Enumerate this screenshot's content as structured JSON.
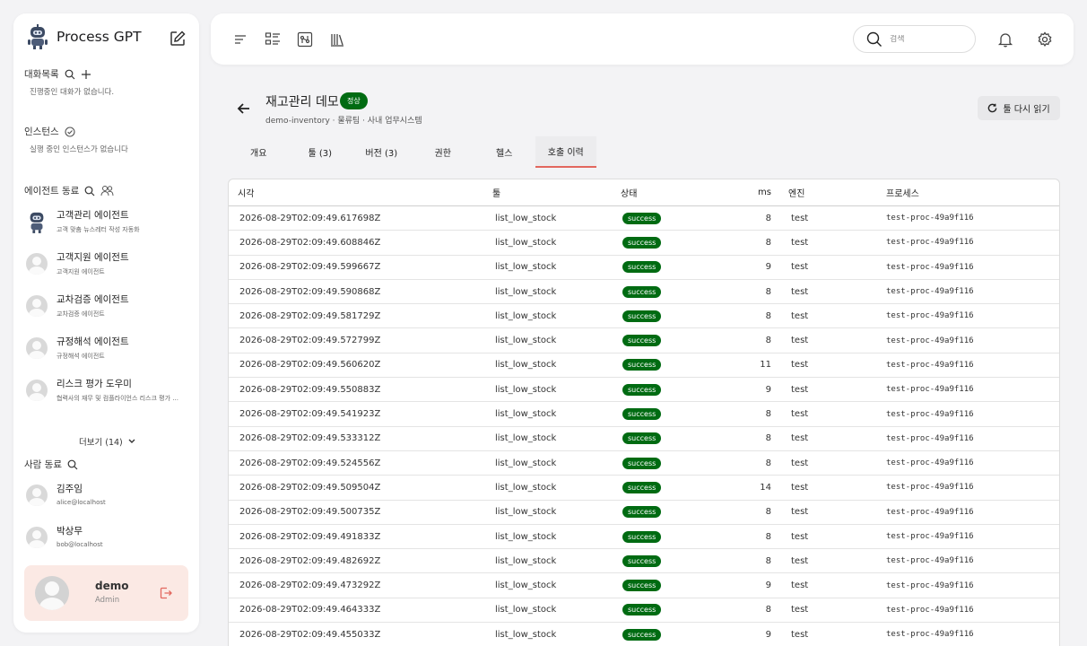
{
  "app": {
    "title": "Process GPT"
  },
  "sidebar": {
    "chats": {
      "title": "대화목록",
      "empty": "진행중인 대화가 없습니다."
    },
    "instances": {
      "title": "인스턴스",
      "empty": "실행 중인 인스턴스가 없습니다"
    },
    "agents": {
      "title": "에이전트 동료",
      "items": [
        {
          "name": "고객관리 에이전트",
          "desc": "고객 맞춤 뉴스레터 작성 자동화"
        },
        {
          "name": "고객지원 에이전트",
          "desc": "고객지원 에이전트"
        },
        {
          "name": "교차검증 에이전트",
          "desc": "교차검증 에이전트"
        },
        {
          "name": "규정해석 에이전트",
          "desc": "규정해석 에이전트"
        },
        {
          "name": "리스크 평가 도우미",
          "desc": "협력사의 재무 및 컴플라이언스 리스크 평가 ..."
        }
      ],
      "more": "더보기 (14)"
    },
    "people": {
      "title": "사람 동료",
      "items": [
        {
          "name": "김주임",
          "email": "alice@localhost"
        },
        {
          "name": "박상무",
          "email": "bob@localhost"
        }
      ]
    },
    "profile": {
      "name": "demo",
      "role": "Admin"
    }
  },
  "topbar": {
    "search_placeholder": "검색"
  },
  "header": {
    "title": "재고관리 데모",
    "status": "정상",
    "subtitle": "demo-inventory · 물류팀 · 사내 업무시스템",
    "reload": "툴 다시 읽기"
  },
  "tabs": [
    {
      "label": "개요"
    },
    {
      "label": "툴 (3)"
    },
    {
      "label": "버전 (3)"
    },
    {
      "label": "권한"
    },
    {
      "label": "헬스"
    },
    {
      "label": "호출 이력"
    }
  ],
  "table": {
    "headers": {
      "time": "시각",
      "tool": "툴",
      "state": "상태",
      "ms": "ms",
      "engine": "엔진",
      "process": "프로세스"
    },
    "rows": [
      {
        "time": "2026-08-29T02:09:49.617698Z",
        "tool": "list_low_stock",
        "state": "success",
        "ms": "8",
        "engine": "test",
        "process": "test-proc-49a9f116"
      },
      {
        "time": "2026-08-29T02:09:49.608846Z",
        "tool": "list_low_stock",
        "state": "success",
        "ms": "8",
        "engine": "test",
        "process": "test-proc-49a9f116"
      },
      {
        "time": "2026-08-29T02:09:49.599667Z",
        "tool": "list_low_stock",
        "state": "success",
        "ms": "9",
        "engine": "test",
        "process": "test-proc-49a9f116"
      },
      {
        "time": "2026-08-29T02:09:49.590868Z",
        "tool": "list_low_stock",
        "state": "success",
        "ms": "8",
        "engine": "test",
        "process": "test-proc-49a9f116"
      },
      {
        "time": "2026-08-29T02:09:49.581729Z",
        "tool": "list_low_stock",
        "state": "success",
        "ms": "8",
        "engine": "test",
        "process": "test-proc-49a9f116"
      },
      {
        "time": "2026-08-29T02:09:49.572799Z",
        "tool": "list_low_stock",
        "state": "success",
        "ms": "8",
        "engine": "test",
        "process": "test-proc-49a9f116"
      },
      {
        "time": "2026-08-29T02:09:49.560620Z",
        "tool": "list_low_stock",
        "state": "success",
        "ms": "11",
        "engine": "test",
        "process": "test-proc-49a9f116"
      },
      {
        "time": "2026-08-29T02:09:49.550883Z",
        "tool": "list_low_stock",
        "state": "success",
        "ms": "9",
        "engine": "test",
        "process": "test-proc-49a9f116"
      },
      {
        "time": "2026-08-29T02:09:49.541923Z",
        "tool": "list_low_stock",
        "state": "success",
        "ms": "8",
        "engine": "test",
        "process": "test-proc-49a9f116"
      },
      {
        "time": "2026-08-29T02:09:49.533312Z",
        "tool": "list_low_stock",
        "state": "success",
        "ms": "8",
        "engine": "test",
        "process": "test-proc-49a9f116"
      },
      {
        "time": "2026-08-29T02:09:49.524556Z",
        "tool": "list_low_stock",
        "state": "success",
        "ms": "8",
        "engine": "test",
        "process": "test-proc-49a9f116"
      },
      {
        "time": "2026-08-29T02:09:49.509504Z",
        "tool": "list_low_stock",
        "state": "success",
        "ms": "14",
        "engine": "test",
        "process": "test-proc-49a9f116"
      },
      {
        "time": "2026-08-29T02:09:49.500735Z",
        "tool": "list_low_stock",
        "state": "success",
        "ms": "8",
        "engine": "test",
        "process": "test-proc-49a9f116"
      },
      {
        "time": "2026-08-29T02:09:49.491833Z",
        "tool": "list_low_stock",
        "state": "success",
        "ms": "8",
        "engine": "test",
        "process": "test-proc-49a9f116"
      },
      {
        "time": "2026-08-29T02:09:49.482692Z",
        "tool": "list_low_stock",
        "state": "success",
        "ms": "8",
        "engine": "test",
        "process": "test-proc-49a9f116"
      },
      {
        "time": "2026-08-29T02:09:49.473292Z",
        "tool": "list_low_stock",
        "state": "success",
        "ms": "9",
        "engine": "test",
        "process": "test-proc-49a9f116"
      },
      {
        "time": "2026-08-29T02:09:49.464333Z",
        "tool": "list_low_stock",
        "state": "success",
        "ms": "8",
        "engine": "test",
        "process": "test-proc-49a9f116"
      },
      {
        "time": "2026-08-29T02:09:49.455033Z",
        "tool": "list_low_stock",
        "state": "success",
        "ms": "9",
        "engine": "test",
        "process": "test-proc-49a9f116"
      }
    ]
  },
  "colors": {
    "success": "#006b12",
    "accent": "#e2675e",
    "profile_bg": "#fbe9e4"
  }
}
